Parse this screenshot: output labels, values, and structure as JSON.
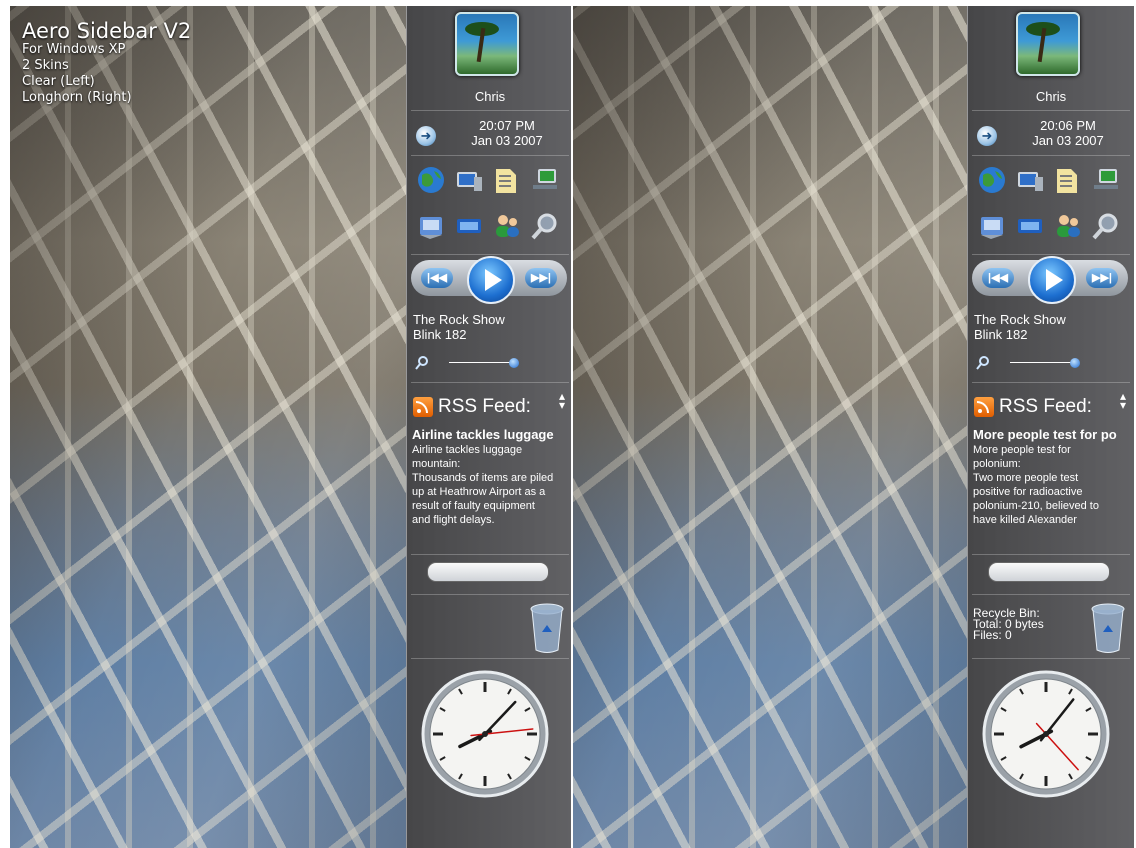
{
  "caption": {
    "title": "Aero Sidebar V2",
    "lines": [
      "For Windows XP",
      "2 Skins",
      "Clear (Left)",
      "Longhorn (Right)"
    ]
  },
  "left_sidebar": {
    "user_name": "Chris",
    "time": "20:07 PM",
    "date": "Jan 03 2007",
    "song_title": "The Rock Show",
    "song_artist": "Blink 182",
    "rss_label": "RSS Feed:",
    "rss_headline": "Airline tackles luggage",
    "rss_lines": [
      "Airline tackles luggage",
      "mountain:",
      "Thousands of items are piled",
      "up at Heathrow Airport as a",
      "result of faulty equipment",
      "and flight delays."
    ],
    "clock": {
      "hour": 8,
      "minute": 7,
      "second": 14
    }
  },
  "right_sidebar": {
    "user_name": "Chris",
    "time": "20:06 PM",
    "date": "Jan 03 2007",
    "song_title": "The Rock Show",
    "song_artist": "Blink 182",
    "rss_label": "RSS Feed:",
    "rss_headline": "More people test for po",
    "rss_lines": [
      "More people test for",
      "polonium:",
      "Two more people test",
      "positive for radioactive",
      "polonium-210, believed to",
      "have killed Alexander"
    ],
    "recycle_lines": [
      "Recycle Bin:",
      "Total: 0 bytes",
      "Files: 0"
    ],
    "clock": {
      "hour": 8,
      "minute": 6,
      "second": 23
    }
  },
  "launch_icons": [
    "globe-icon",
    "my-computer-icon",
    "documents-folder-icon",
    "network-icon",
    "control-panel-icon",
    "display-icon",
    "users-icon",
    "search-magnifier-icon"
  ],
  "colors": {
    "accent_blue": "#1f6ad0",
    "rss_orange": "#e8720c",
    "clock_second_hand": "#cc1111"
  }
}
